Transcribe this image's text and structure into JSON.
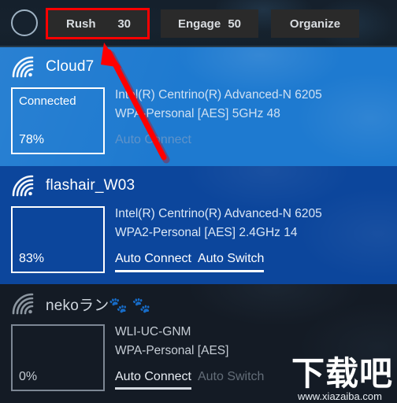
{
  "toolbar": {
    "circle_button_name": "circle-toggle",
    "buttons": [
      {
        "label": "Rush",
        "value": "30",
        "highlighted": true
      },
      {
        "label": "Engage",
        "value": "50",
        "highlighted": false
      },
      {
        "label": "Organize",
        "value": "",
        "highlighted": false
      }
    ],
    "highlight_color": "#ff0000"
  },
  "annotation": {
    "arrow_color": "#ff0000",
    "points_to": "Rush button"
  },
  "networks": [
    {
      "ssid": "Cloud7",
      "status": "Connected",
      "percent": "78%",
      "adapter": "Intel(R) Centrino(R) Advanced-N 6205",
      "security": "WPA-Personal [AES] 5GHz 48",
      "auto_connect": "Auto Connect",
      "auto_switch": "",
      "selected": true,
      "row_color": "#1e7ad0"
    },
    {
      "ssid": "flashair_W03",
      "status": "",
      "percent": "83%",
      "adapter": "Intel(R) Centrino(R) Advanced-N 6205",
      "security": "WPA2-Personal [AES] 2.4GHz 14",
      "auto_connect": "Auto Connect",
      "auto_switch": "Auto Switch",
      "selected": false,
      "row_color": "#0c469c"
    },
    {
      "ssid": "nekoラン🐾 🐾",
      "status": "",
      "percent": "0%",
      "adapter": "WLI-UC-GNM",
      "security": "WPA-Personal [AES]",
      "auto_connect": "Auto Connect",
      "auto_switch": "Auto Switch",
      "selected": false,
      "row_color": "#141b25"
    }
  ],
  "watermark": {
    "text": "下载吧",
    "url": "www.xiazaiba.com"
  }
}
